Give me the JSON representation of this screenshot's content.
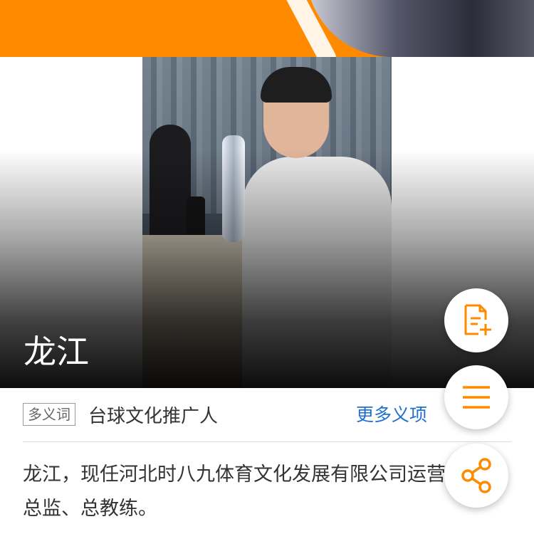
{
  "entry": {
    "title": "龙江",
    "polysemy_tag": "多义词",
    "sense_label": "台球文化推广人",
    "more_senses_label": "更多义项",
    "summary": "龙江，现任河北时八九体育文化发展有限公司运营总监、总教练。"
  },
  "icons": {
    "add_entry": "document-plus-icon",
    "menu": "hamburger-menu-icon",
    "share": "share-icon",
    "more_senses": "chevron-down-icon"
  },
  "colors": {
    "accent": "#ff8a00",
    "link": "#1f6fd1"
  }
}
